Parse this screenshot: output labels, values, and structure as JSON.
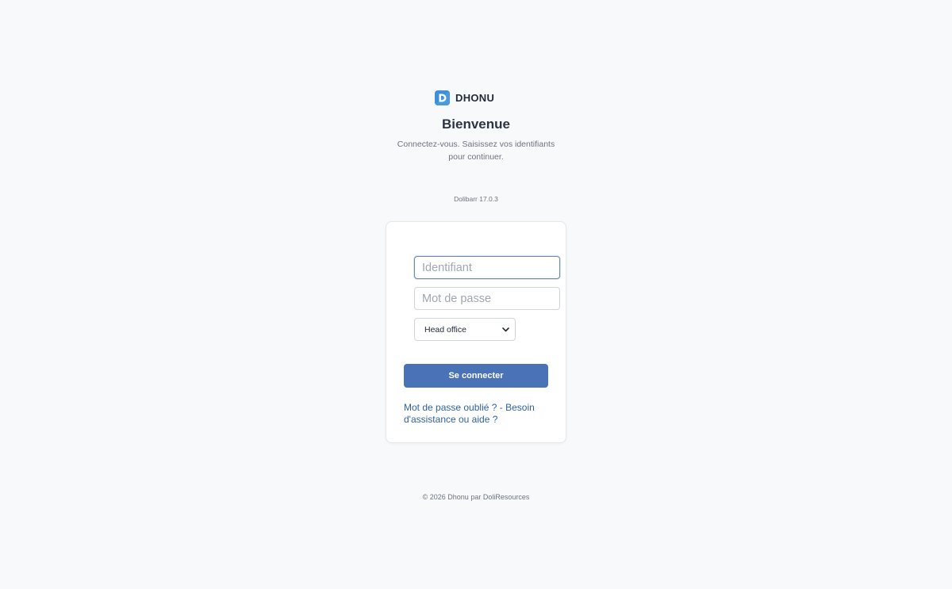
{
  "brand": {
    "name": "DHONU",
    "logo_letter": "D",
    "logo_color": "#3f8fd6"
  },
  "login_page": {
    "title": "Bienvenue",
    "subtitle": "Connectez-vous. Saisissez vos identifiants pour continuer.",
    "version": "Dolibarr 17.0.3"
  },
  "form": {
    "login_placeholder": "Identifiant",
    "login_value": "",
    "password_placeholder": "Mot de passe",
    "password_value": "",
    "entity_selected": "Head office",
    "submit_label": "Se connecter",
    "forgot_password_link": "Mot de passe oublié ?",
    "link_separator": "-",
    "help_link": "Besoin d'assistance ou aide ?",
    "accent_color": "#4a72b6",
    "link_color": "#2e62a8"
  },
  "footer": {
    "text": "© 2026 Dhonu par DoliResources"
  }
}
